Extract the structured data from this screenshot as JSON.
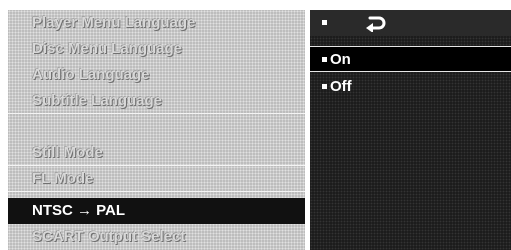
{
  "menu": {
    "items": [
      {
        "label": "Player Menu Language"
      },
      {
        "label": "Disc Menu Language"
      },
      {
        "label": "Audio Language"
      },
      {
        "label": "Subtitle Language"
      },
      {
        "label": "Still Mode"
      },
      {
        "label": "FL Mode"
      },
      {
        "label": "NTSC → PAL"
      },
      {
        "label": "SCART Output Select"
      }
    ],
    "active_index": 6
  },
  "options": {
    "header_icon": "return-icon",
    "items": [
      {
        "label": "On",
        "selected": true
      },
      {
        "label": "Off",
        "selected": false
      }
    ]
  }
}
